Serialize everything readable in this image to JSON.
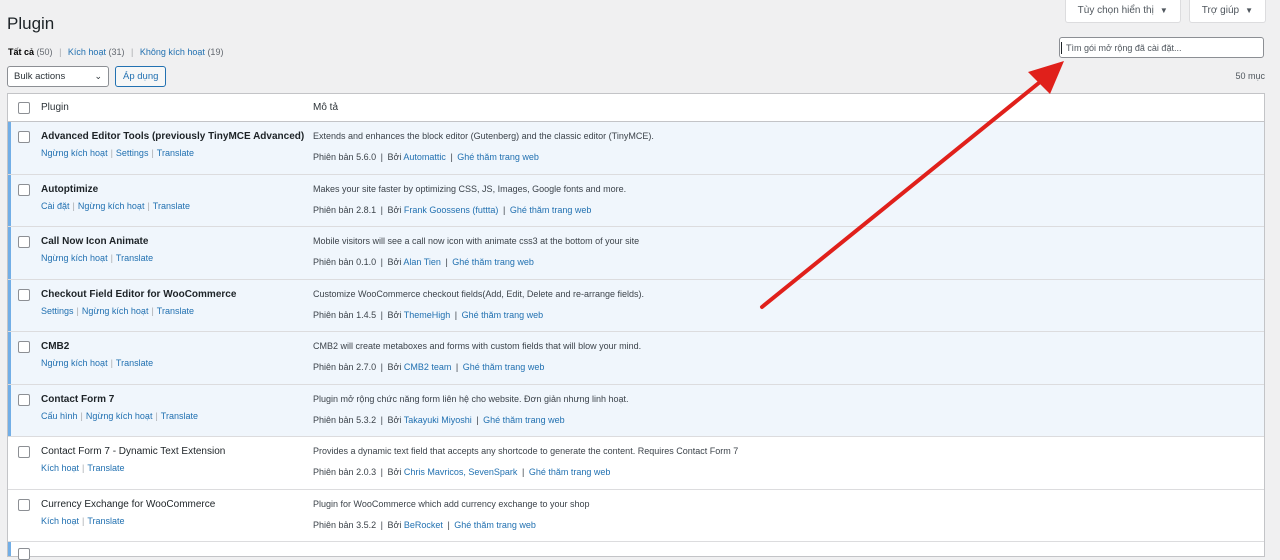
{
  "header": {
    "title": "Plugin",
    "screen_options": "Tùy chọn hiển thị",
    "help": "Trợ giúp"
  },
  "filters": {
    "all_label": "Tất cả",
    "all_count": "(50)",
    "active_label": "Kích hoạt",
    "active_count": "(31)",
    "inactive_label": "Không kích hoạt",
    "inactive_count": "(19)"
  },
  "search": {
    "placeholder": "Tìm gói mở rộng đã cài đặt..."
  },
  "bulk": {
    "selected": "Bulk actions",
    "apply": "Áp dụng"
  },
  "item_count": "50 mục",
  "table": {
    "col_plugin": "Plugin",
    "col_desc": "Mô tả",
    "meta": {
      "version_prefix": "Phiên bản",
      "by_prefix": "Bởi",
      "visit": "Ghé thăm trang web"
    },
    "rows": [
      {
        "name": "Advanced Editor Tools (previously TinyMCE Advanced)",
        "actions": [
          "Ngừng kích hoạt",
          "Settings",
          "Translate"
        ],
        "desc": "Extends and enhances the block editor (Gutenberg) and the classic editor (TinyMCE).",
        "version": "5.6.0",
        "author": "Automattic"
      },
      {
        "name": "Autoptimize",
        "actions": [
          "Cài đặt",
          "Ngừng kích hoạt",
          "Translate"
        ],
        "desc": "Makes your site faster by optimizing CSS, JS, Images, Google fonts and more.",
        "version": "2.8.1",
        "author": "Frank Goossens (futtta)"
      },
      {
        "name": "Call Now Icon Animate",
        "actions": [
          "Ngừng kích hoạt",
          "Translate"
        ],
        "desc": "Mobile visitors will see a call now icon with animate css3 at the bottom of your site",
        "version": "0.1.0",
        "author": "Alan Tien"
      },
      {
        "name": "Checkout Field Editor for WooCommerce",
        "actions": [
          "Settings",
          "Ngừng kích hoạt",
          "Translate"
        ],
        "desc": "Customize WooCommerce checkout fields(Add, Edit, Delete and re-arrange fields).",
        "version": "1.4.5",
        "author": "ThemeHigh"
      },
      {
        "name": "CMB2",
        "actions": [
          "Ngừng kích hoạt",
          "Translate"
        ],
        "desc": "CMB2 will create metaboxes and forms with custom fields that will blow your mind.",
        "version": "2.7.0",
        "author": "CMB2 team"
      },
      {
        "name": "Contact Form 7",
        "actions": [
          "Cấu hình",
          "Ngừng kích hoạt",
          "Translate"
        ],
        "desc": "Plugin mở rộng chức năng form liên hệ cho website. Đơn giản nhưng linh hoạt.",
        "version": "5.3.2",
        "author": "Takayuki Miyoshi"
      },
      {
        "name": "Contact Form 7 - Dynamic Text Extension",
        "actions": [
          "Kích hoạt",
          "Translate"
        ],
        "desc": "Provides a dynamic text field that accepts any shortcode to generate the content. Requires Contact Form 7",
        "version": "2.0.3",
        "author": "Chris Mavricos, SevenSpark"
      },
      {
        "name": "Currency Exchange for WooCommerce",
        "actions": [
          "Kích hoạt",
          "Translate"
        ],
        "desc": "Plugin for WooCommerce which add currency exchange to your shop",
        "version": "3.5.2",
        "author": "BeRocket"
      }
    ]
  },
  "colors": {
    "active_row_bg": "#f0f6fc",
    "active_border": "#72aee6",
    "link": "#2271b1",
    "annotation_arrow": "#e0201b"
  }
}
